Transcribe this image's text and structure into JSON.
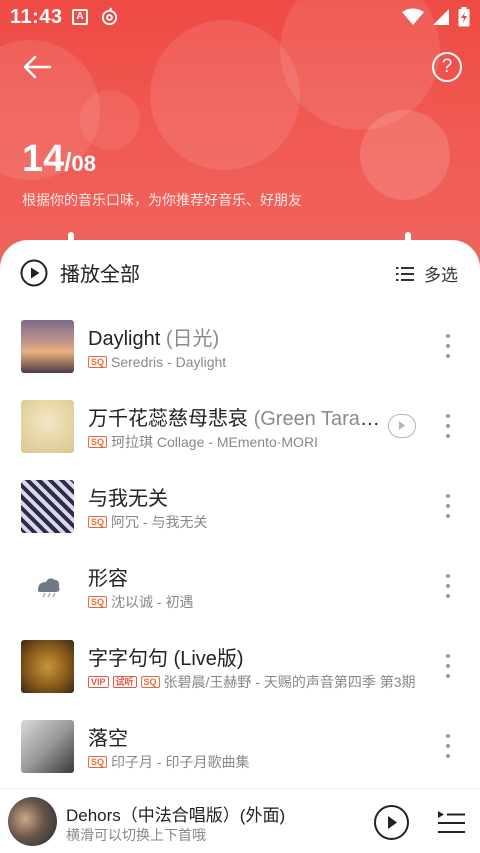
{
  "status_bar": {
    "time": "11:43",
    "icons": [
      "A-badge-icon",
      "netease-icon",
      "wifi-icon",
      "signal-icon",
      "battery-charging-icon"
    ]
  },
  "header": {
    "date_day": "14",
    "date_separator": "/",
    "date_month": "08",
    "subtitle": "根据你的音乐口味，为你推荐好音乐、好朋友",
    "help_label": "?"
  },
  "toolbar": {
    "play_all_label": "播放全部",
    "multi_select_label": "多选"
  },
  "songs": [
    {
      "title": "Daylight",
      "alt": "(日光)",
      "tags": [
        "SQ"
      ],
      "meta": "Seredris - Daylight",
      "has_mv": false
    },
    {
      "title": "万千花蕊慈母悲哀",
      "alt": "(Green Tara'…",
      "tags": [
        "SQ"
      ],
      "meta": "珂拉琪 Collage - MEmento·MORI",
      "has_mv": true
    },
    {
      "title": "与我无关",
      "alt": "",
      "tags": [
        "SQ"
      ],
      "meta": "阿冗 - 与我无关",
      "has_mv": false
    },
    {
      "title": "形容",
      "alt": "",
      "tags": [
        "SQ"
      ],
      "meta": "沈以诚 - 初遇",
      "has_mv": false
    },
    {
      "title": "字字句句 (Live版)",
      "alt": "",
      "tags": [
        "VIP",
        "试听",
        "SQ"
      ],
      "meta": "张碧晨/王赫野 - 天赐的声音第四季 第3期",
      "has_mv": false
    },
    {
      "title": "落空",
      "alt": "",
      "tags": [
        "SQ"
      ],
      "meta": "印子月 - 印子月歌曲集",
      "has_mv": false
    }
  ],
  "player": {
    "title": "Dehors（中法合唱版）(外面)",
    "hint": "横滑可以切换上下首哦"
  },
  "colors": {
    "hero_red": "#ee4a43",
    "tag_orange": "#e86a3a",
    "text_dark": "#222222",
    "text_gray": "#888888"
  }
}
